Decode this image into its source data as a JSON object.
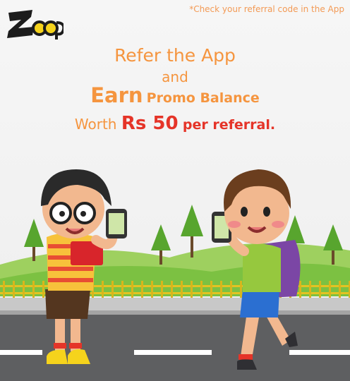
{
  "brand": {
    "logo_text": "Zoop"
  },
  "note": "*Check your referral code in the App",
  "headline": {
    "line1": "Refer the App",
    "line2": "and",
    "line3_strong": "Earn",
    "line3_rest": "Promo Balance",
    "line4_start": "Worth",
    "line4_amount": "Rs 50",
    "line4_end": "per referral",
    "line4_dot": "."
  },
  "colors": {
    "accent_orange": "#f5953f",
    "accent_red": "#e53428",
    "grass": "#7cc142",
    "road": "#5e5f61"
  }
}
